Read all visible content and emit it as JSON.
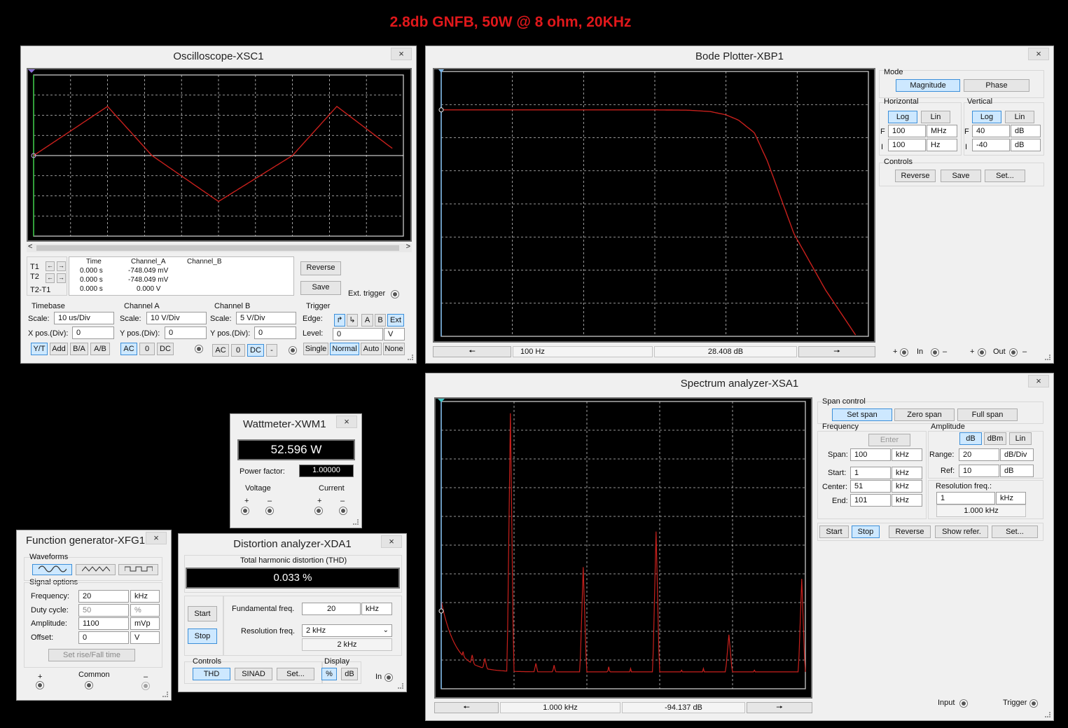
{
  "headline": "2.8db GNFB, 50W @ 8 ohm, 20KHz",
  "close_glyph": "×",
  "colors": {
    "trace": "#c8201c",
    "headline": "#e0181b",
    "grid": "#c8c8c8",
    "active_button": "#cde8ff"
  },
  "oscilloscope": {
    "title": "Oscilloscope-XSC1",
    "readout": {
      "headers": [
        "Time",
        "Channel_A",
        "Channel_B"
      ],
      "rows": [
        {
          "label": "T1",
          "time": "0.000 s",
          "a": "-748.049 mV",
          "b": ""
        },
        {
          "label": "T2",
          "time": "0.000 s",
          "a": "-748.049 mV",
          "b": ""
        },
        {
          "label": "T2-T1",
          "time": "0.000 s",
          "a": "0.000 V",
          "b": ""
        }
      ]
    },
    "reverse": "Reverse",
    "save": "Save",
    "ext_trigger": "Ext. trigger",
    "timebase": {
      "title": "Timebase",
      "scale_label": "Scale:",
      "scale": "10 us/Div",
      "xpos_label": "X pos.(Div):",
      "xpos": "0",
      "modes": [
        "Y/T",
        "Add",
        "B/A",
        "A/B"
      ]
    },
    "channel_a": {
      "title": "Channel A",
      "scale_label": "Scale:",
      "scale": "10  V/Div",
      "ypos_label": "Y pos.(Div):",
      "ypos": "0",
      "coupling": [
        "AC",
        "0",
        "DC"
      ]
    },
    "channel_b": {
      "title": "Channel B",
      "scale_label": "Scale:",
      "scale": "5  V/Div",
      "ypos_label": "Y pos.(Div):",
      "ypos": "0",
      "coupling": [
        "AC",
        "0",
        "DC",
        "-"
      ]
    },
    "trigger": {
      "title": "Trigger",
      "edge_label": "Edge:",
      "edges": [
        "A",
        "B",
        "Ext"
      ],
      "level_label": "Level:",
      "level": "0",
      "level_unit": "V",
      "modes": [
        "Single",
        "Normal",
        "Auto",
        "None"
      ]
    }
  },
  "bode": {
    "title": "Bode Plotter-XBP1",
    "mode_label": "Mode",
    "magnitude": "Magnitude",
    "phase": "Phase",
    "horizontal": {
      "title": "Horizontal",
      "log": "Log",
      "lin": "Lin",
      "f_label": "F",
      "f_value": "100",
      "f_unit": "MHz",
      "i_label": "I",
      "i_value": "100",
      "i_unit": "Hz"
    },
    "vertical": {
      "title": "Vertical",
      "log": "Log",
      "lin": "Lin",
      "f_label": "F",
      "f_value": "40",
      "f_unit": "dB",
      "i_label": "I",
      "i_value": "-40",
      "i_unit": "dB"
    },
    "controls": {
      "title": "Controls",
      "reverse": "Reverse",
      "save": "Save",
      "set": "Set..."
    },
    "freq_readout": "100  Hz",
    "db_readout": "28.408 dB",
    "in_label": "In",
    "out_label": "Out",
    "plus": "+",
    "minus": "–"
  },
  "spectrum": {
    "title": "Spectrum analyzer-XSA1",
    "span_control": {
      "title": "Span control",
      "set_span": "Set span",
      "zero_span": "Zero span",
      "full_span": "Full span"
    },
    "frequency": {
      "title": "Frequency",
      "enter": "Enter",
      "span_label": "Span:",
      "span": "100",
      "span_unit": "kHz",
      "start_label": "Start:",
      "start": "1",
      "start_unit": "kHz",
      "center_label": "Center:",
      "center": "51",
      "center_unit": "kHz",
      "end_label": "End:",
      "end": "101",
      "end_unit": "kHz"
    },
    "amplitude": {
      "title": "Amplitude",
      "db": "dB",
      "dbm": "dBm",
      "lin": "Lin",
      "range_label": "Range:",
      "range": "20",
      "range_unit": "dB/Div",
      "ref_label": "Ref:",
      "ref": "10",
      "ref_unit": "dB"
    },
    "resolution": {
      "title": "Resolution freq.:",
      "value": "1",
      "unit": "kHz",
      "readout": "1.000 kHz"
    },
    "buttons": {
      "start": "Start",
      "stop": "Stop",
      "reverse": "Reverse",
      "show_refer": "Show refer.",
      "set": "Set..."
    },
    "freq_readout": "1.000 kHz",
    "db_readout": "-94.137  dB",
    "input_label": "Input",
    "trigger_label": "Trigger"
  },
  "wattmeter": {
    "title": "Wattmeter-XWM1",
    "reading": "52.596 W",
    "pf_label": "Power factor:",
    "pf": "1.00000",
    "voltage": "Voltage",
    "current": "Current",
    "plus": "+",
    "minus": "–"
  },
  "function_generator": {
    "title": "Function generator-XFG1",
    "waveforms_label": "Waveforms",
    "signal_options": "Signal options",
    "frequency_label": "Frequency:",
    "frequency": "20",
    "frequency_unit": "kHz",
    "duty_label": "Duty cycle:",
    "duty": "50",
    "duty_unit": "%",
    "amplitude_label": "Amplitude:",
    "amplitude": "1100",
    "amplitude_unit": "mVp",
    "offset_label": "Offset:",
    "offset": "0",
    "offset_unit": "V",
    "rise_fall": "Set rise/Fall time",
    "plus": "+",
    "common": "Common",
    "minus": "–"
  },
  "distortion": {
    "title": "Distortion analyzer-XDA1",
    "thd_label": "Total harmonic distortion (THD)",
    "thd": "0.033 %",
    "start": "Start",
    "stop": "Stop",
    "fund_label": "Fundamental freq.",
    "fund": "20",
    "fund_unit": "kHz",
    "res_label": "Resolution freq.",
    "res_select": "2 kHz",
    "res_readout": "2 kHz",
    "controls_label": "Controls",
    "thd_btn": "THD",
    "sinad_btn": "SINAD",
    "set_btn": "Set...",
    "display_label": "Display",
    "pct_btn": "%",
    "db_btn": "dB",
    "in_label": "In"
  },
  "chart_data": [
    {
      "type": "line",
      "title": "",
      "xlabel": "",
      "ylabel": "",
      "x": [
        0,
        4,
        6.4,
        10,
        14,
        16.4,
        20
      ],
      "series": [
        {
          "values": [
            0,
            0,
            0,
            0,
            0,
            0,
            0
          ]
        },
        {
          "values": [
            0,
            12.2,
            0,
            -11.4,
            0,
            12.2,
            -0.3
          ]
        }
      ],
      "grid": true
    },
    {
      "type": "line",
      "title": "",
      "xlabel": "",
      "ylabel": "",
      "xscale": "log",
      "x": [
        100,
        1000,
        10000,
        100000,
        300000,
        600000,
        1000000,
        1500000,
        2500000,
        3800000,
        9000000,
        25000000,
        68000000
      ],
      "series": [
        {
          "values": [
            28.4,
            28.4,
            28.4,
            28.4,
            28.3,
            27.9,
            26.9,
            25.3,
            21.5,
            13,
            -9,
            -26,
            -40
          ]
        }
      ],
      "xlim": [
        100,
        100000000
      ],
      "ylim": [
        -40,
        40
      ],
      "grid": true
    },
    {
      "type": "line",
      "title": "",
      "xlabel": "",
      "ylabel": "",
      "x": [
        1,
        6,
        11,
        16,
        20,
        21,
        40,
        41,
        60,
        61,
        80,
        100
      ],
      "series": [
        {
          "values": [
            -94,
            -118,
            -126,
            -130,
            23,
            -130,
            -68,
            -135,
            -47,
            -136,
            -108,
            -75
          ]
        }
      ],
      "xlim": [
        1,
        101
      ],
      "ylim": [
        -140,
        30
      ],
      "grid": true
    }
  ]
}
